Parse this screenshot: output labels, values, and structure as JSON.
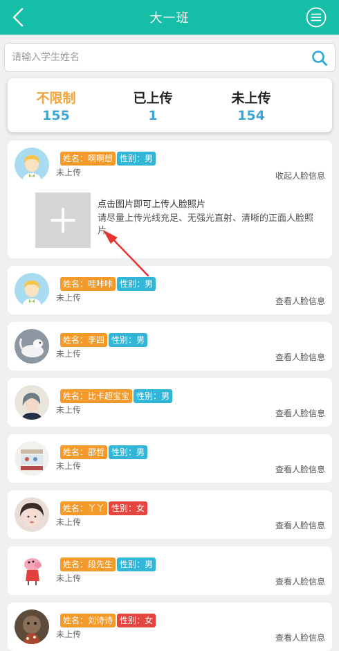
{
  "header": {
    "title": "大一班"
  },
  "search": {
    "placeholder": "请输入学生姓名"
  },
  "stats": [
    {
      "label": "不限制",
      "value": "155",
      "active": true
    },
    {
      "label": "已上传",
      "value": "1",
      "active": false
    },
    {
      "label": "未上传",
      "value": "154",
      "active": false
    }
  ],
  "upload": {
    "hint1": "点击图片即可上传人脸照片",
    "hint2": "请尽量上传光线充足、无强光直射、清晰的正面人脸照片"
  },
  "students": [
    {
      "name": "姓名：啊啊想",
      "gender": "性别：男",
      "status": "未上传",
      "action": "收起人脸信息"
    },
    {
      "name": "姓名：哇咔咔",
      "gender": "性别：男",
      "status": "未上传",
      "action": "查看人脸信息"
    },
    {
      "name": "姓名：李四",
      "gender": "性别：男",
      "status": "未上传",
      "action": "查看人脸信息"
    },
    {
      "name": "姓名：比卡超宝宝",
      "gender": "性别：男",
      "status": "未上传",
      "action": "查看人脸信息"
    },
    {
      "name": "姓名：邵哲",
      "gender": "性别：男",
      "status": "未上传",
      "action": "查看人脸信息"
    },
    {
      "name": "姓名：丫丫",
      "gender": "性别：女",
      "status": "未上传",
      "action": "查看人脸信息"
    },
    {
      "name": "姓名：段先生",
      "gender": "性别：男",
      "status": "未上传",
      "action": "查看人脸信息"
    },
    {
      "name": "姓名：刘诗诗",
      "gender": "性别：女",
      "status": "未上传",
      "action": "查看人脸信息"
    }
  ]
}
